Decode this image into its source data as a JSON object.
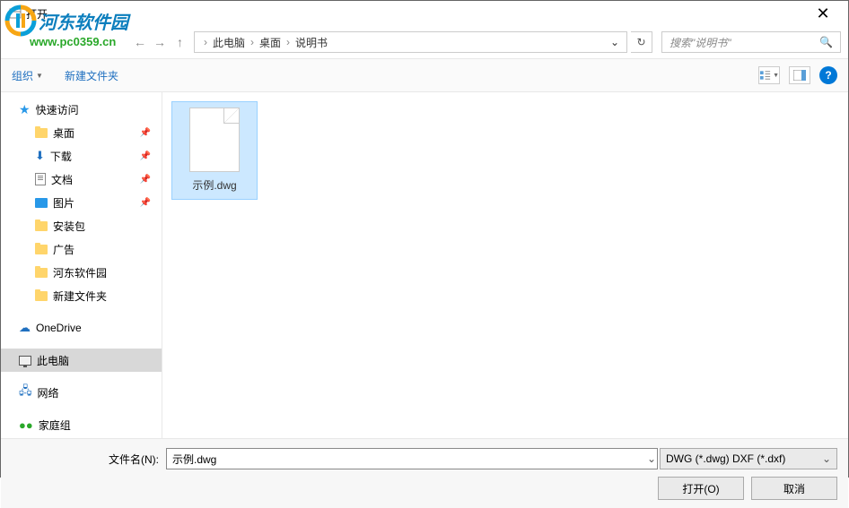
{
  "window": {
    "title": "打开"
  },
  "watermark": {
    "text": "河东软件园",
    "url": "www.pc0359.cn"
  },
  "nav": {
    "breadcrumb": [
      "此电脑",
      "桌面",
      "说明书"
    ],
    "search_placeholder": "搜索\"说明书\""
  },
  "toolbar": {
    "organize": "组织",
    "new_folder": "新建文件夹"
  },
  "sidebar": {
    "quick_access": "快速访问",
    "desktop": "桌面",
    "downloads": "下载",
    "documents": "文档",
    "pictures": "图片",
    "install_pkg": "安装包",
    "ads": "广告",
    "hedong": "河东软件园",
    "new_folder": "新建文件夹",
    "onedrive": "OneDrive",
    "this_pc": "此电脑",
    "network": "网络",
    "homegroup": "家庭组"
  },
  "files": [
    {
      "name": "示例.dwg",
      "selected": true
    }
  ],
  "footer": {
    "filename_label": "文件名(N):",
    "filename_value": "示例.dwg",
    "filetype": "DWG (*.dwg) DXF (*.dxf)",
    "open_btn": "打开(O)",
    "cancel_btn": "取消"
  }
}
